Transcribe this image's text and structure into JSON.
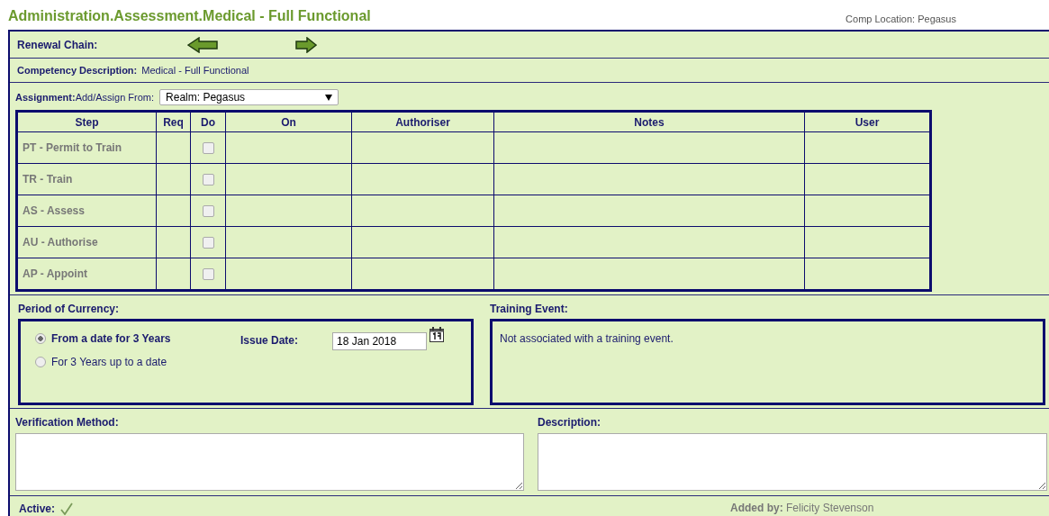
{
  "page": {
    "title": "Administration.Assessment.Medical - Full Functional",
    "comp_location": "Comp Location: Pegasus"
  },
  "renewal_chain": {
    "label": "Renewal Chain:"
  },
  "competency": {
    "label": "Competency Description:",
    "value": "Medical - Full Functional"
  },
  "assignment": {
    "label": "Assignment:",
    "from_label": "Add/Assign From:",
    "from_value": "Realm: Pegasus"
  },
  "steps_table": {
    "columns": [
      "Step",
      "Req",
      "Do",
      "On",
      "Authoriser",
      "Notes",
      "User"
    ],
    "rows": [
      {
        "step": "PT - Permit to Train",
        "do_checked": false
      },
      {
        "step": "TR - Train",
        "do_checked": false
      },
      {
        "step": "AS - Assess",
        "do_checked": false
      },
      {
        "step": "AU - Authorise",
        "do_checked": false
      },
      {
        "step": "AP - Appoint",
        "do_checked": false
      }
    ]
  },
  "period_of_currency": {
    "label": "Period of Currency:",
    "options": [
      {
        "label": "From a date for 3 Years",
        "selected": true
      },
      {
        "label": "For 3 Years up to a date",
        "selected": false
      }
    ],
    "issue_date_label": "Issue Date:",
    "issue_date": "18 Jan 2018"
  },
  "training_event": {
    "label": "Training Event:",
    "text": "Not associated with a training event."
  },
  "verification_method": {
    "label": "Verification Method:"
  },
  "description": {
    "label": "Description:"
  },
  "footer": {
    "active_label": "Active:",
    "active": true,
    "added_by": "**Added by:** Felicity Stevenson"
  }
}
